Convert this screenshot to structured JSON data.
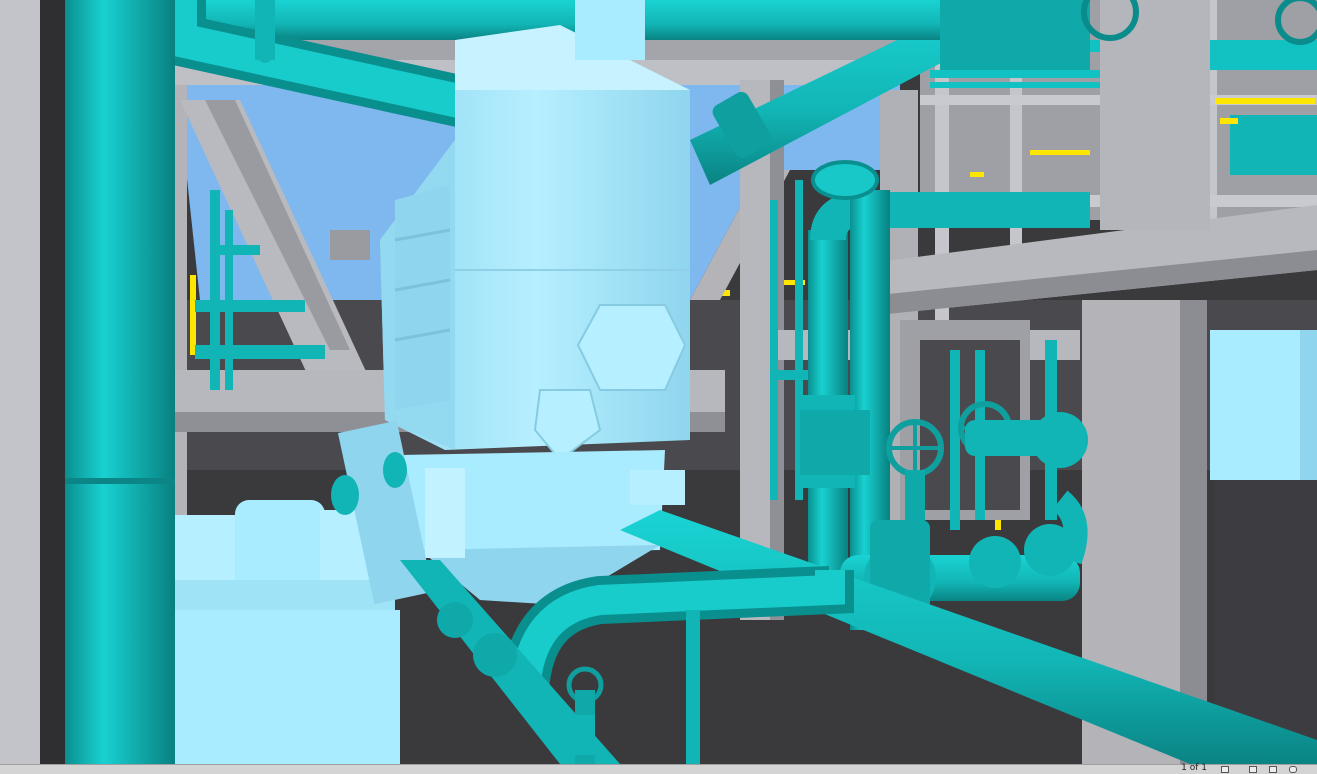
{
  "viewer": {
    "page_indicator": "1 of 1",
    "colors": {
      "pipe": "#12c1c1",
      "pipe_shade": "#0a9494",
      "equipment": "#a9ebff",
      "equipment_shade": "#7fcbe3",
      "steel": "#b3b3b8",
      "steel_dark": "#8c8c92",
      "floor": "#3a3a3d",
      "sky": "#7fb8ee",
      "handrail_highlight": "#ffe600"
    },
    "status_icons": [
      "nav-prev-icon",
      "nav-next-icon",
      "page-icon",
      "print-icon",
      "lock-icon"
    ]
  }
}
